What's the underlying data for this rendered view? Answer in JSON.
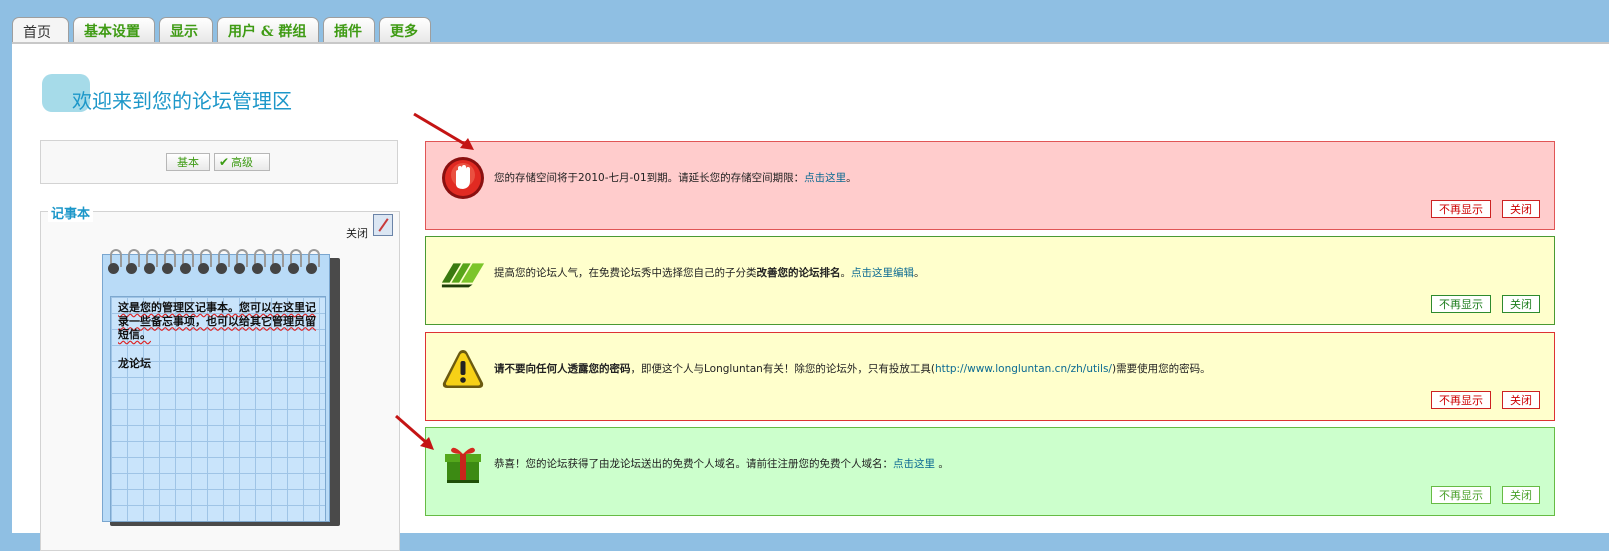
{
  "tabs": [
    {
      "label": "首页",
      "active": true
    },
    {
      "label": "基本设置"
    },
    {
      "label": "显示"
    },
    {
      "label": "用户 & 群组"
    },
    {
      "label": "插件"
    },
    {
      "label": "更多"
    }
  ],
  "page": {
    "title": "欢迎来到您的论坛管理区"
  },
  "mode": {
    "basic": "基本",
    "advanced": "高级"
  },
  "notepad": {
    "legend": "记事本",
    "close_label": "关闭",
    "text": "这是您的管理区记事本。您可以在这里记录一些备忘事项，也可以给其它管理员留短信。",
    "signature": "龙论坛"
  },
  "notices": [
    {
      "type": "stop",
      "text_before": "您的存储空间将于2010-七月-01到期。请延长您的存储空间期限：",
      "bold": "",
      "link": "点击这里",
      "text_after": "。",
      "hide_label": "不再显示",
      "close_label": "关闭"
    },
    {
      "type": "promote",
      "text_before": "提高您的论坛人气，在免费论坛秀中选择您自己的子分类",
      "bold": "改善您的论坛排名",
      "link": "点击这里编辑",
      "text_after": "。",
      "hide_label": "不再显示",
      "close_label": "关闭"
    },
    {
      "type": "warning",
      "text_before": "",
      "bold": "请不要向任何人透露您的密码",
      "text_mid": "，即便这个人与Longluntan有关！除您的论坛外，只有投放工具(",
      "link": "http://www.longluntan.cn/zh/utils/",
      "text_after": ")需要使用您的密码。",
      "hide_label": "不再显示",
      "close_label": "关闭"
    },
    {
      "type": "gift",
      "text_before": "恭喜！您的论坛获得了由龙论坛送出的免费个人域名。请前往注册您的免费个人域名：",
      "bold": "",
      "link": "点击这里",
      "text_after": " 。",
      "hide_label": "不再显示",
      "close_label": "关闭"
    }
  ],
  "colors": {
    "red_bg": "#ffcccc",
    "yellow_bg": "#ffffcc",
    "green_bg": "#ccffcc",
    "title": "#1d97c9",
    "tab_text": "#3f9b14",
    "link": "#0b6a92"
  },
  "icons": {
    "notice_0": "stop-hand-icon",
    "notice_1": "forward-arrows-icon",
    "notice_2": "warning-icon",
    "notice_3": "gift-icon"
  }
}
